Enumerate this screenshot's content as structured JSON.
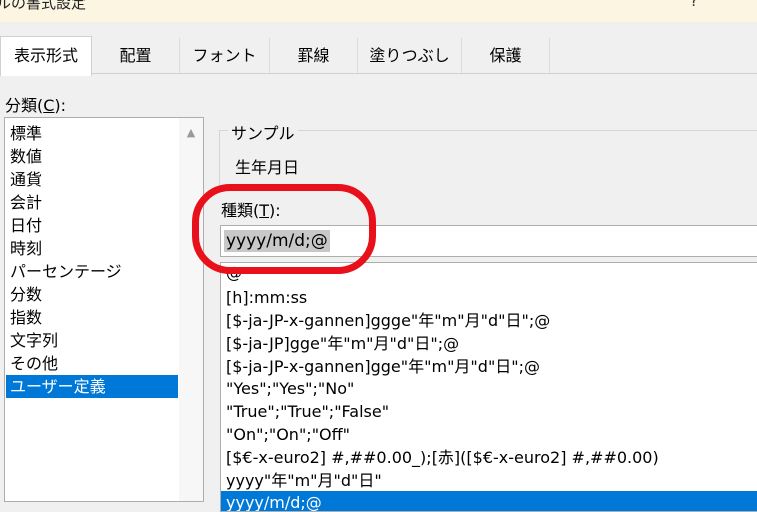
{
  "window": {
    "title": "ルの書式設定",
    "help": "?"
  },
  "tabs": [
    {
      "label": "表示形式",
      "active": true
    },
    {
      "label": "配置"
    },
    {
      "label": "フォント"
    },
    {
      "label": "罫線"
    },
    {
      "label": "塗りつぶし"
    },
    {
      "label": "保護"
    }
  ],
  "category": {
    "label_prefix": "分類(",
    "label_key": "C",
    "label_suffix": "):",
    "items": [
      "標準",
      "数値",
      "通貨",
      "会計",
      "日付",
      "時刻",
      "パーセンテージ",
      "分数",
      "指数",
      "文字列",
      "その他",
      "ユーザー定義"
    ],
    "selected": "ユーザー定義"
  },
  "sample": {
    "label": "サンプル",
    "value": "生年月日"
  },
  "type": {
    "label_prefix": "種類(",
    "label_key": "T",
    "label_suffix": "):",
    "value": "yyyy/m/d;@"
  },
  "format_list": {
    "items": [
      "@",
      "[h]:mm:ss",
      "[$-ja-JP-x-gannen]ggge\"年\"m\"月\"d\"日\";@",
      "[$-ja-JP]gge\"年\"m\"月\"d\"日\";@",
      "[$-ja-JP-x-gannen]gge\"年\"m\"月\"d\"日\";@",
      "\"Yes\";\"Yes\";\"No\"",
      "\"True\";\"True\";\"False\"",
      "\"On\";\"On\";\"Off\"",
      "[$€-x-euro2] #,##0.00_);[赤]([$€-x-euro2] #,##0.00)",
      "yyyy\"年\"m\"月\"d\"日\"",
      "yyyy/m/d;@"
    ],
    "selected": "yyyy/m/d;@"
  },
  "colors": {
    "selection": "#0078d7",
    "annotation": "#e8101a"
  }
}
